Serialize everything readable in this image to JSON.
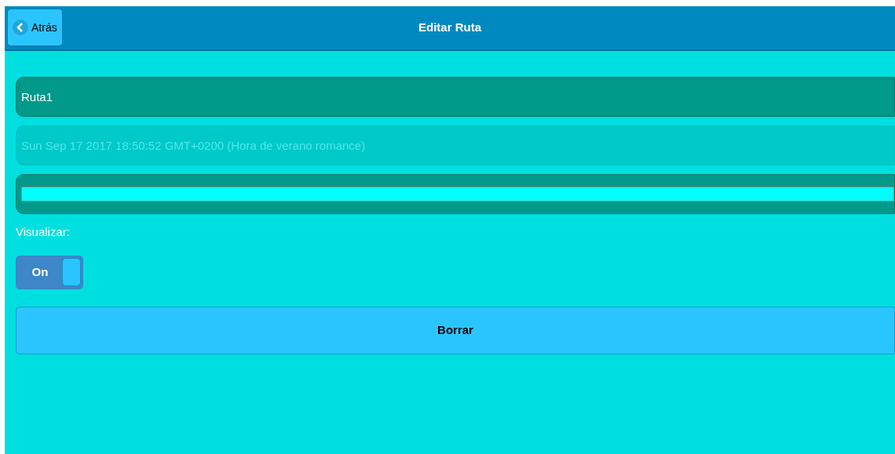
{
  "header": {
    "back_button": "Atrás",
    "title": "Editar Ruta"
  },
  "form": {
    "name_field": {
      "value": "Ruta1"
    },
    "date_field": {
      "value": "Sun Sep 17 2017 18:50:52 GMT+0200 (Hora de verano romance)",
      "disabled": true
    },
    "color_field": {
      "color": "#00ffff"
    },
    "visibility_label": "Visualizar:",
    "visibility_switch": {
      "label": "On",
      "on": true
    },
    "delete_button": "Borrar"
  }
}
